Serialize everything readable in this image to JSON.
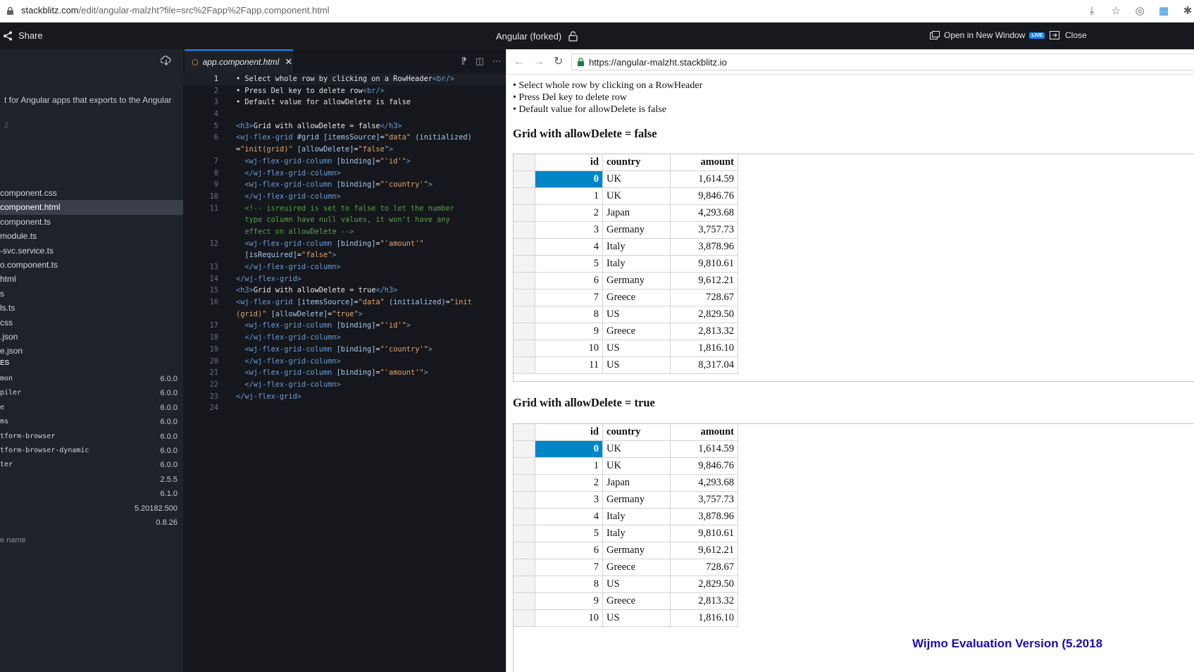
{
  "browser": {
    "url_host": "stackblitz.com",
    "url_path": "/edit/angular-malzht?file=src%2Fapp%2Fapp.component.html"
  },
  "ide": {
    "share_label": "Share",
    "project_title": "Angular (forked)",
    "open_window_label": "Open in New Window",
    "live_badge": "LIVE",
    "close_label": "Close"
  },
  "sidebar": {
    "description": "t for Angular apps that exports to the Angular",
    "line_number": "2",
    "files": [
      "component.css",
      "component.html",
      "component.ts",
      "module.ts",
      "-svc.service.ts",
      "o.component.ts",
      "html",
      "s",
      "ls.ts",
      "css",
      ".json",
      "e.json"
    ],
    "active_file_index": 1,
    "deps_header": "ES",
    "deps": [
      {
        "name": "mon",
        "version": "6.0.0"
      },
      {
        "name": "piler",
        "version": "6.0.0"
      },
      {
        "name": "e",
        "version": "6.0.0"
      },
      {
        "name": "ms",
        "version": "6.0.0"
      },
      {
        "name": "tform-browser",
        "version": "6.0.0"
      },
      {
        "name": "tform-browser-dynamic",
        "version": "6.0.0"
      },
      {
        "name": "ter",
        "version": "6.0.0"
      },
      {
        "name": "",
        "version": "2.5.5"
      },
      {
        "name": "",
        "version": "6.1.0"
      },
      {
        "name": "",
        "version": "5.20182.500"
      },
      {
        "name": "",
        "version": "0.8.26"
      }
    ],
    "new_dep_placeholder": "e name"
  },
  "editor": {
    "tab_label": "app.component.html",
    "tab_icon": "html5-icon",
    "lines": [
      {
        "n": "1",
        "cur": true,
        "tokens": [
          [
            "t",
            "• Select whole row by clicking on a RowHeader"
          ],
          [
            "tag",
            "<br/>"
          ]
        ]
      },
      {
        "n": "2",
        "tokens": [
          [
            "t",
            "• Press Del key to delete row"
          ],
          [
            "tag",
            "<br/>"
          ]
        ]
      },
      {
        "n": "3",
        "tokens": [
          [
            "t",
            "• Default value for allowDelete is false"
          ]
        ]
      },
      {
        "n": "4",
        "tokens": []
      },
      {
        "n": "5",
        "tokens": [
          [
            "tag",
            "<h3>"
          ],
          [
            "t",
            "Grid with allowDelete = false"
          ],
          [
            "tag",
            "</h3>"
          ]
        ]
      },
      {
        "n": "6",
        "tokens": [
          [
            "tag",
            "<wj-flex-grid "
          ],
          [
            "attr",
            "#grid [itemsSource]"
          ],
          [
            "t",
            "="
          ],
          [
            "str",
            "\"data\""
          ],
          [
            "attr",
            " (initialized)"
          ]
        ]
      },
      {
        "n": "",
        "tokens": [
          [
            "t",
            "="
          ],
          [
            "str",
            "\"init(grid)\""
          ],
          [
            "attr",
            " [allowDelete]"
          ],
          [
            "t",
            "="
          ],
          [
            "str",
            "\"false\""
          ],
          [
            "tag",
            ">"
          ]
        ]
      },
      {
        "n": "7",
        "tokens": [
          [
            "tag",
            "  <wj-flex-grid-column "
          ],
          [
            "attr",
            "[binding]"
          ],
          [
            "t",
            "="
          ],
          [
            "str",
            "\"'id'\""
          ],
          [
            "tag",
            ">"
          ]
        ]
      },
      {
        "n": "8",
        "tokens": [
          [
            "tag",
            "  </wj-flex-grid-column>"
          ]
        ]
      },
      {
        "n": "9",
        "tokens": [
          [
            "tag",
            "  <wj-flex-grid-column "
          ],
          [
            "attr",
            "[binding]"
          ],
          [
            "t",
            "="
          ],
          [
            "str",
            "\"'country'\""
          ],
          [
            "tag",
            ">"
          ]
        ]
      },
      {
        "n": "10",
        "tokens": [
          [
            "tag",
            "  </wj-flex-grid-column>"
          ]
        ]
      },
      {
        "n": "11",
        "tokens": [
          [
            "com",
            "  <!-- isreuired is set to false to let the number"
          ]
        ]
      },
      {
        "n": "",
        "tokens": [
          [
            "com",
            "  type column have null values, it won't have any"
          ]
        ]
      },
      {
        "n": "",
        "tokens": [
          [
            "com",
            "  effect on allowDelete -->"
          ]
        ]
      },
      {
        "n": "12",
        "tokens": [
          [
            "tag",
            "  <wj-flex-grid-column "
          ],
          [
            "attr",
            "[binding]"
          ],
          [
            "t",
            "="
          ],
          [
            "str",
            "\"'amount'\""
          ]
        ]
      },
      {
        "n": "",
        "tokens": [
          [
            "attr",
            "  [isRequired]"
          ],
          [
            "t",
            "="
          ],
          [
            "str",
            "\"false\""
          ],
          [
            "tag",
            ">"
          ]
        ]
      },
      {
        "n": "13",
        "tokens": [
          [
            "tag",
            "  </wj-flex-grid-column>"
          ]
        ]
      },
      {
        "n": "14",
        "tokens": [
          [
            "tag",
            "</wj-flex-grid>"
          ]
        ]
      },
      {
        "n": "15",
        "tokens": [
          [
            "tag",
            "<h3>"
          ],
          [
            "t",
            "Grid with allowDelete = true"
          ],
          [
            "tag",
            "</h3>"
          ]
        ]
      },
      {
        "n": "16",
        "tokens": [
          [
            "tag",
            "<wj-flex-grid "
          ],
          [
            "attr",
            "[itemsSource]"
          ],
          [
            "t",
            "="
          ],
          [
            "str",
            "\"data\""
          ],
          [
            "attr",
            " (initialized)"
          ],
          [
            "t",
            "="
          ],
          [
            "str",
            "\"init"
          ]
        ]
      },
      {
        "n": "",
        "tokens": [
          [
            "str",
            "(grid)\""
          ],
          [
            "attr",
            " [allowDelete]"
          ],
          [
            "t",
            "="
          ],
          [
            "str",
            "\"true\""
          ],
          [
            "tag",
            ">"
          ]
        ]
      },
      {
        "n": "17",
        "tokens": [
          [
            "tag",
            "  <wj-flex-grid-column "
          ],
          [
            "attr",
            "[binding]"
          ],
          [
            "t",
            "="
          ],
          [
            "str",
            "\"'id'\""
          ],
          [
            "tag",
            ">"
          ]
        ]
      },
      {
        "n": "18",
        "tokens": [
          [
            "tag",
            "  </wj-flex-grid-column>"
          ]
        ]
      },
      {
        "n": "19",
        "tokens": [
          [
            "tag",
            "  <wj-flex-grid-column "
          ],
          [
            "attr",
            "[binding]"
          ],
          [
            "t",
            "="
          ],
          [
            "str",
            "\"'country'\""
          ],
          [
            "tag",
            ">"
          ]
        ]
      },
      {
        "n": "20",
        "tokens": [
          [
            "tag",
            "  </wj-flex-grid-column>"
          ]
        ]
      },
      {
        "n": "21",
        "tokens": [
          [
            "tag",
            "  <wj-flex-grid-column "
          ],
          [
            "attr",
            "[binding]"
          ],
          [
            "t",
            "="
          ],
          [
            "str",
            "\"'amount'\""
          ],
          [
            "tag",
            ">"
          ]
        ]
      },
      {
        "n": "22",
        "tokens": [
          [
            "tag",
            "  </wj-flex-grid-column>"
          ]
        ]
      },
      {
        "n": "23",
        "tokens": [
          [
            "tag",
            "</wj-flex-grid>"
          ]
        ]
      },
      {
        "n": "24",
        "tokens": []
      }
    ]
  },
  "preview": {
    "url": "https://angular-malzht.stackblitz.io",
    "bullets": [
      "• Select whole row by clicking on a RowHeader",
      "• Press Del key to delete row",
      "• Default value for allowDelete is false"
    ],
    "grid1_title": "Grid with allowDelete = false",
    "grid2_title": "Grid with allowDelete = true",
    "columns": [
      "id",
      "country",
      "amount"
    ],
    "rows": [
      [
        "0",
        "UK",
        "1,614.59"
      ],
      [
        "1",
        "UK",
        "9,846.76"
      ],
      [
        "2",
        "Japan",
        "4,293.68"
      ],
      [
        "3",
        "Germany",
        "3,757.73"
      ],
      [
        "4",
        "Italy",
        "3,878.96"
      ],
      [
        "5",
        "Italy",
        "9,810.61"
      ],
      [
        "6",
        "Germany",
        "9,612.21"
      ],
      [
        "7",
        "Greece",
        "728.67"
      ],
      [
        "8",
        "US",
        "2,829.50"
      ],
      [
        "9",
        "Greece",
        "2,813.32"
      ],
      [
        "10",
        "US",
        "1,816.10"
      ],
      [
        "11",
        "US",
        "8,317.04"
      ]
    ],
    "watermark": "Wijmo Evaluation Version (5.2018"
  },
  "colors": {
    "selected_cell": "#0085c7",
    "live_badge": "#1389fd",
    "editor_bg": "#15171c",
    "sidebar_bg": "#1f2228"
  }
}
